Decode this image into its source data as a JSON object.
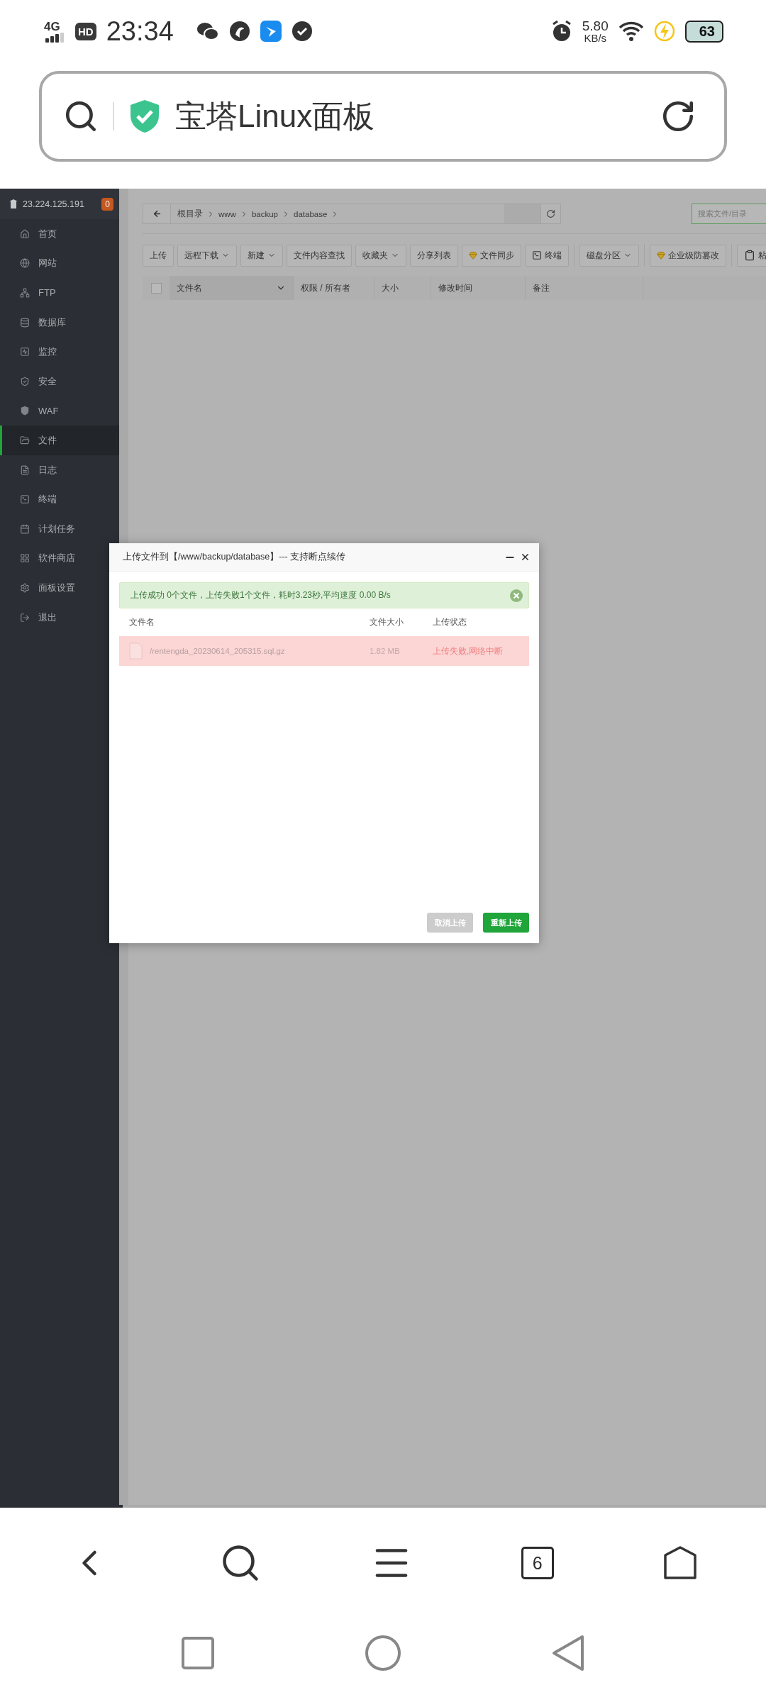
{
  "status_bar": {
    "network": "4G",
    "hd": "HD",
    "time": "23:34",
    "speed": "5.80",
    "speed_unit": "KB/s",
    "battery": "63"
  },
  "address_bar": {
    "title": "宝塔Linux面板"
  },
  "sidebar": {
    "server_ip": "23.224.125.191",
    "notification_count": "0",
    "items": [
      {
        "label": "首页",
        "selected": false
      },
      {
        "label": "网站",
        "selected": false
      },
      {
        "label": "FTP",
        "selected": false
      },
      {
        "label": "数据库",
        "selected": false
      },
      {
        "label": "监控",
        "selected": false
      },
      {
        "label": "安全",
        "selected": false
      },
      {
        "label": "WAF",
        "selected": false
      },
      {
        "label": "文件",
        "selected": true
      },
      {
        "label": "日志",
        "selected": false
      },
      {
        "label": "终端",
        "selected": false
      },
      {
        "label": "计划任务",
        "selected": false
      },
      {
        "label": "软件商店",
        "selected": false
      },
      {
        "label": "面板设置",
        "selected": false
      },
      {
        "label": "退出",
        "selected": false
      }
    ]
  },
  "file_manager": {
    "breadcrumb": [
      "根目录",
      "www",
      "backup",
      "database"
    ],
    "search": {
      "placeholder": "搜索文件/目录"
    },
    "toolbar_groups": [
      {
        "buttons": [
          {
            "label": "上传",
            "kind": "plain"
          },
          {
            "label": "远程下载",
            "kind": "dropdown"
          },
          {
            "label": "新建",
            "kind": "dropdown"
          },
          {
            "label": "文件内容查找",
            "kind": "plain"
          },
          {
            "label": "收藏夹",
            "kind": "dropdown"
          },
          {
            "label": "分享列表",
            "kind": "plain"
          },
          {
            "label": "文件同步",
            "kind": "premium"
          },
          {
            "label": "终端",
            "kind": "terminal"
          }
        ]
      },
      {
        "buttons": [
          {
            "label": "磁盘分区",
            "kind": "dropdown"
          }
        ]
      },
      {
        "buttons": [
          {
            "label": "企业级防篡改",
            "kind": "premium"
          }
        ]
      },
      {
        "buttons": [
          {
            "label": "粘",
            "kind": "paste"
          }
        ]
      }
    ],
    "select_all": {
      "checked": false
    },
    "columns": [
      {
        "label": "文件名",
        "sorted": true
      },
      {
        "label": "权限 / 所有者",
        "sorted": false
      },
      {
        "label": "大小",
        "sorted": false
      },
      {
        "label": "修改时间",
        "sorted": false
      },
      {
        "label": "备注",
        "sorted": false
      }
    ]
  },
  "dialog": {
    "title": "上传文件到【/www/backup/database】--- 支持断点续传",
    "alert": "上传成功 0个文件，上传失败1个文件，耗时3.23秒,平均速度 0.00 B/s",
    "columns": [
      "文件名",
      "文件大小",
      "上传状态"
    ],
    "files": [
      {
        "name": "/rentengda_20230614_205315.sql.gz",
        "size": "1.82 MB",
        "status": "上传失败,网络中断",
        "failed": true
      }
    ],
    "buttons": [
      {
        "label": "取消上传",
        "disabled": true
      },
      {
        "label": "重新上传",
        "disabled": false
      }
    ]
  },
  "browser_nav": {
    "progress": {
      "level": 0.16
    },
    "tab_count": "6"
  }
}
